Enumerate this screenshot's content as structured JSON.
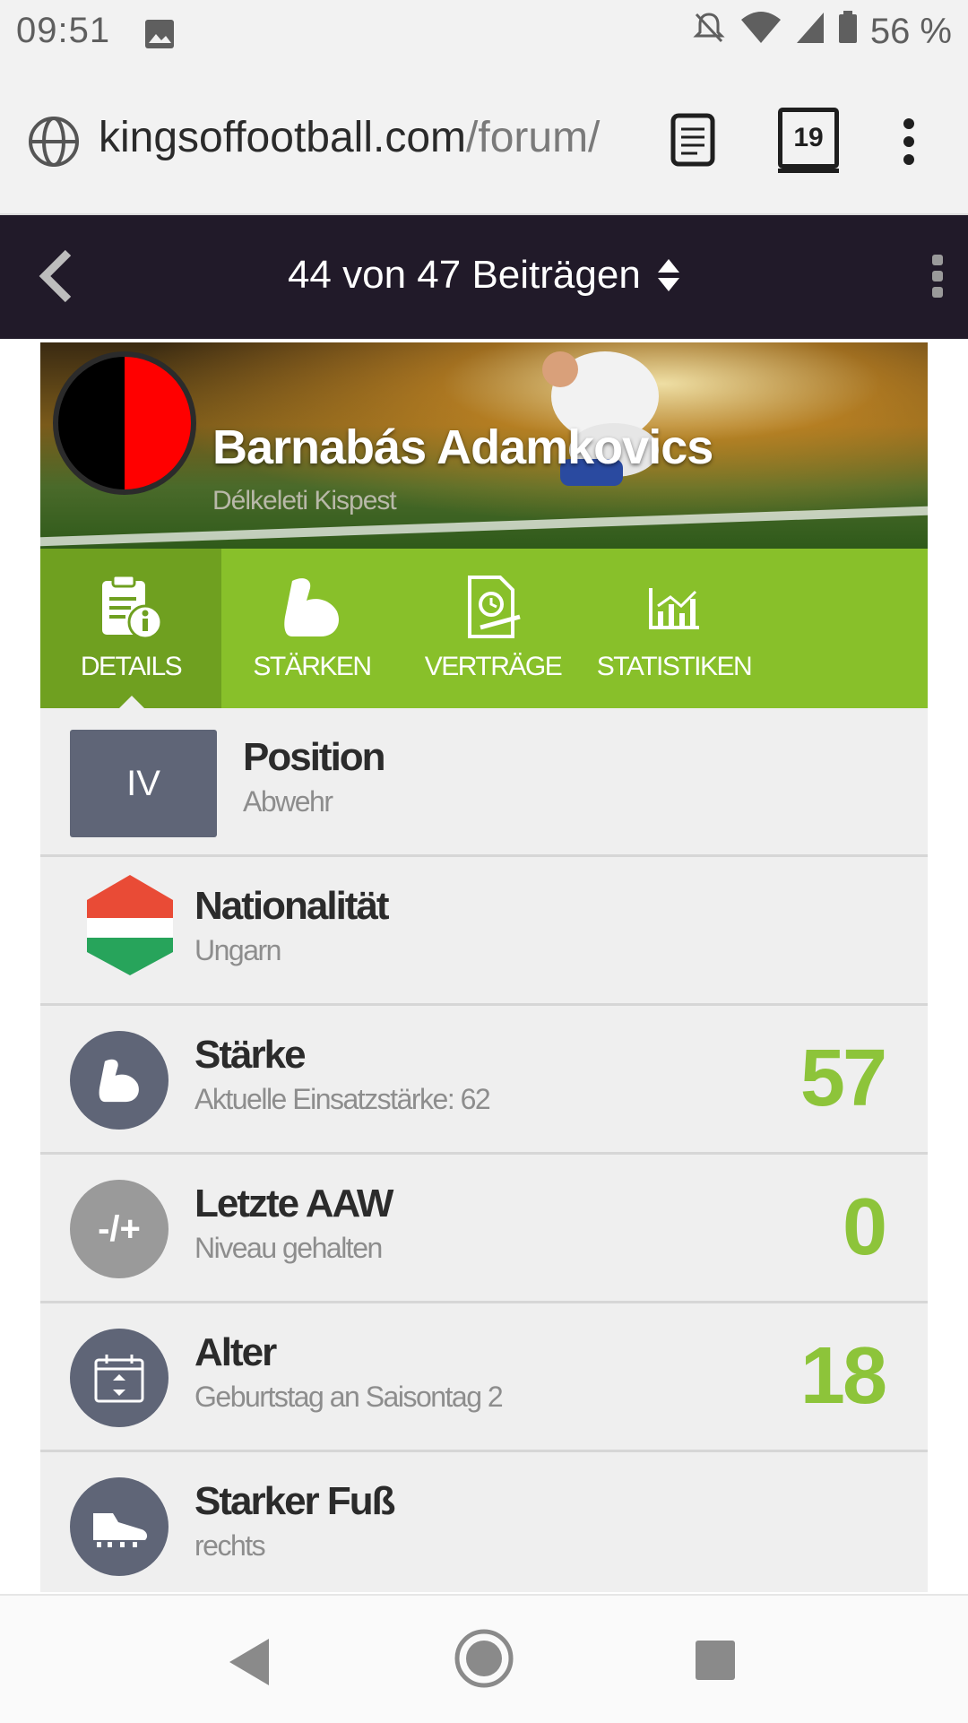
{
  "status": {
    "time": "09:51",
    "battery": "56 %"
  },
  "browser": {
    "url_main": "kingsoffootball.com",
    "url_path": "/forum/",
    "tab_count": "19"
  },
  "forum": {
    "title": "44 von 47 Beiträgen"
  },
  "player": {
    "name": "Barnabás Adamkovics",
    "club": "Délkeleti Kispest"
  },
  "tabs": [
    {
      "label": "DETAILS",
      "icon": "details-icon"
    },
    {
      "label": "STÄRKEN",
      "icon": "muscle-icon"
    },
    {
      "label": "VERTRÄGE",
      "icon": "contract-icon"
    },
    {
      "label": "STATISTIKEN",
      "icon": "chart-icon"
    }
  ],
  "details": {
    "position": {
      "badge": "IV",
      "title": "Position",
      "sub": "Abwehr"
    },
    "nationality": {
      "title": "Nationalität",
      "sub": "Ungarn",
      "flag_colors": [
        "#e94b36",
        "#ffffff",
        "#27a45b"
      ]
    },
    "strength": {
      "title": "Stärke",
      "sub": "Aktuelle Einsatzstärke: 62",
      "value": "57"
    },
    "last_aaw": {
      "badge": "-/+",
      "title": "Letzte AAW",
      "sub": "Niveau gehalten",
      "value": "0"
    },
    "age": {
      "title": "Alter",
      "sub": "Geburtstag an Saisontag 2",
      "value": "18"
    },
    "foot": {
      "title": "Starker Fuß",
      "sub": "rechts"
    }
  },
  "colors": {
    "accent_green": "#88c02a",
    "value_green": "#8dc43a",
    "forum_bar": "#211a29"
  }
}
